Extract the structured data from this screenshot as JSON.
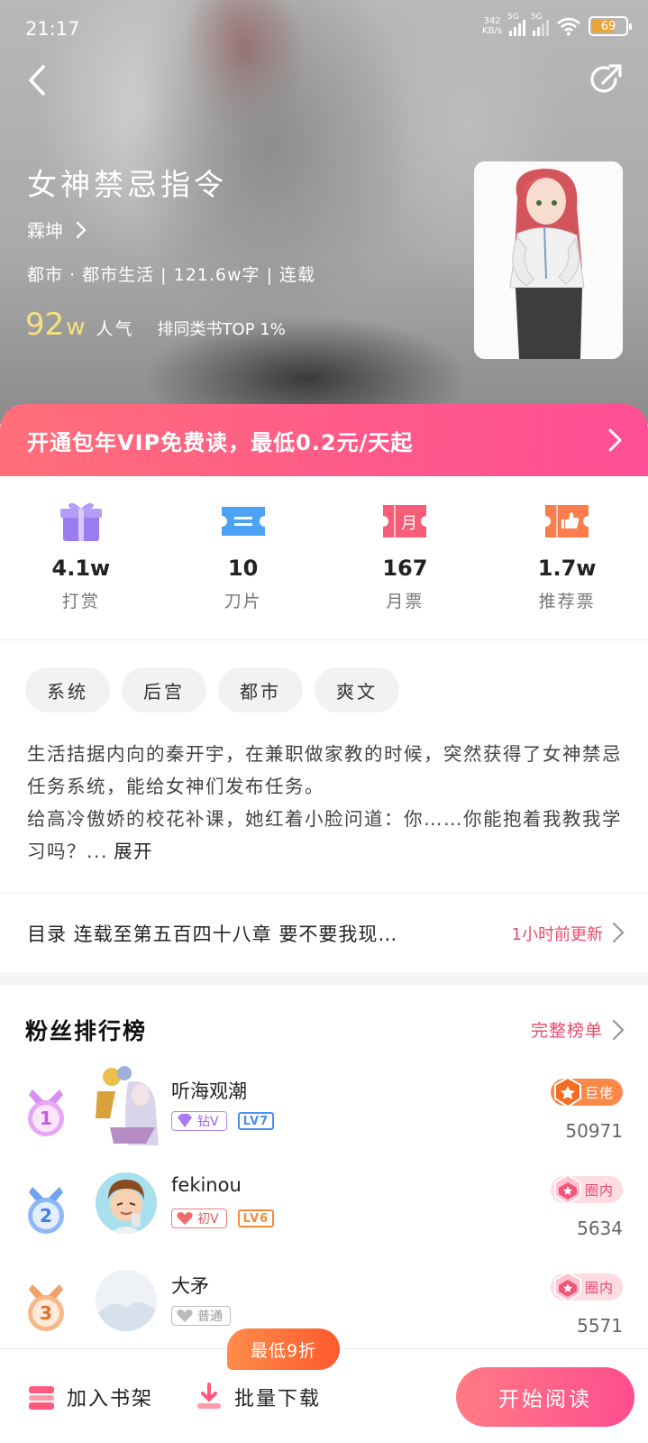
{
  "status_bar": {
    "time": "21:17",
    "net_speed_value": "342",
    "net_speed_unit": "KB/s",
    "signal1_label": "5G",
    "signal2_label": "5G",
    "battery": "69"
  },
  "book": {
    "title": "女神禁忌指令",
    "author": "霖坤",
    "meta": "都市 · 都市生活 | 121.6w字 | 连载",
    "popularity_number": "92",
    "popularity_unit": "w",
    "popularity_label": "人气",
    "rank_text": "排同类书TOP 1%"
  },
  "vip_banner": {
    "text": "开通包年VIP免费读，最低0.2元/天起"
  },
  "stats": [
    {
      "value": "4.1w",
      "label": "打赏",
      "icon": "gift-icon"
    },
    {
      "value": "10",
      "label": "刀片",
      "icon": "blade-ticket-icon"
    },
    {
      "value": "167",
      "label": "月票",
      "icon": "monthly-ticket-icon"
    },
    {
      "value": "1.7w",
      "label": "推荐票",
      "icon": "thumbs-up-ticket-icon"
    }
  ],
  "tags": [
    "系统",
    "后宫",
    "都市",
    "爽文"
  ],
  "description": {
    "line1": "生活拮据内向的秦开宇，在兼职做家教的时候，突然获得了女神禁忌任务系统，能给女神们发布任务。",
    "line2": "给高冷傲娇的校花补课，她红着小脸问道：你……你能抱着我教我学习吗？...",
    "expand": "展开"
  },
  "catalog": {
    "text": "目录 连载至第五百四十八章 要不要我现…",
    "update": "1小时前更新"
  },
  "fans": {
    "title": "粉丝排行榜",
    "all_label": "完整榜单",
    "items": [
      {
        "rank": "1",
        "name": "听海观潮",
        "vip_label": "钻V",
        "level": "LV7",
        "tag": "巨佬",
        "score": "50971"
      },
      {
        "rank": "2",
        "name": "fekinou",
        "vip_label": "初V",
        "level": "LV6",
        "tag": "圈内",
        "score": "5634"
      },
      {
        "rank": "3",
        "name": "大矛",
        "vip_label": "普通",
        "level": "",
        "tag": "圈内",
        "score": "5571"
      }
    ]
  },
  "bottom_bar": {
    "bookshelf": "加入书架",
    "download": "批量下载",
    "start": "开始阅读",
    "discount": "最低9折"
  },
  "colors": {
    "accent_pink": "#ff5a89",
    "popularity_yellow": "#f6e27c",
    "link_red": "#e94b6a",
    "discount_orange": "#ff6a35"
  }
}
